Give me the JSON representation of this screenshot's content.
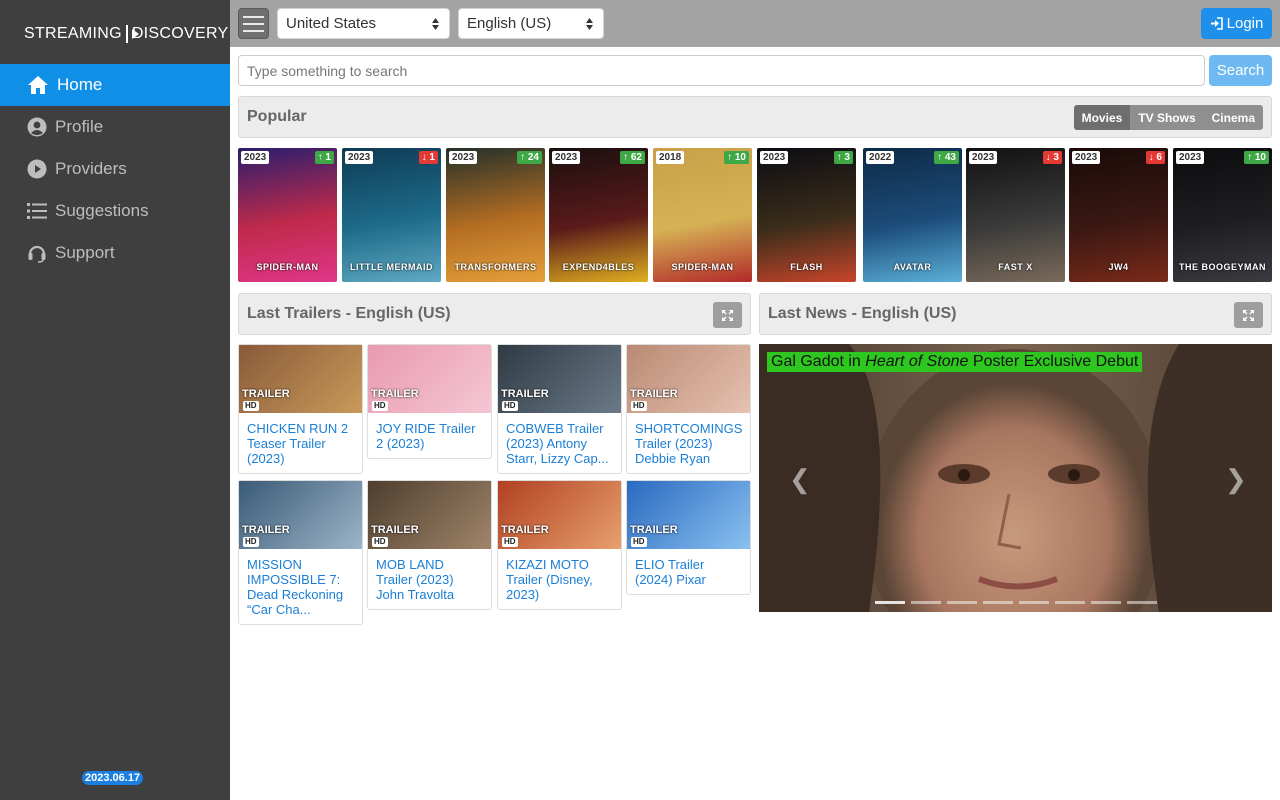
{
  "sidebar": {
    "logo_left": "STREAMING",
    "logo_right": "DISCOVERY",
    "items": [
      {
        "label": "Home",
        "icon": "home-icon"
      },
      {
        "label": "Profile",
        "icon": "user-circle-icon"
      },
      {
        "label": "Providers",
        "icon": "play-circle-icon"
      },
      {
        "label": "Suggestions",
        "icon": "list-icon"
      },
      {
        "label": "Support",
        "icon": "headset-icon"
      }
    ],
    "version": "2023.06.17"
  },
  "topbar": {
    "country": "United States",
    "language": "English (US)",
    "login_label": "Login"
  },
  "search": {
    "placeholder": "Type something to search",
    "button_label": "Search"
  },
  "popular": {
    "title": "Popular",
    "tabs": [
      "Movies",
      "TV Shows",
      "Cinema"
    ],
    "active_tab": "Movies",
    "movies": [
      {
        "year": "2023",
        "rank": "1",
        "trend": "up",
        "poster_text": "SPIDER-MAN"
      },
      {
        "year": "2023",
        "rank": "1",
        "trend": "down",
        "poster_text": "LITTLE MERMAID"
      },
      {
        "year": "2023",
        "rank": "24",
        "trend": "up",
        "poster_text": "TRANSFORMERS"
      },
      {
        "year": "2023",
        "rank": "62",
        "trend": "up",
        "poster_text": "EXPEND4BLES"
      },
      {
        "year": "2018",
        "rank": "10",
        "trend": "up",
        "poster_text": "SPIDER-MAN"
      },
      {
        "year": "2023",
        "rank": "3",
        "trend": "up",
        "poster_text": "FLASH"
      },
      {
        "year": "2022",
        "rank": "43",
        "trend": "up",
        "poster_text": "AVATAR"
      },
      {
        "year": "2023",
        "rank": "3",
        "trend": "down",
        "poster_text": "FAST X"
      },
      {
        "year": "2023",
        "rank": "6",
        "trend": "down",
        "poster_text": "JW4"
      },
      {
        "year": "2023",
        "rank": "10",
        "trend": "up",
        "poster_text": "THE BOOGEYMAN"
      }
    ]
  },
  "trailers": {
    "title": "Last Trailers - English (US)",
    "badge_trailer": "TRAILER",
    "badge_hd": "HD",
    "items": [
      {
        "title": "CHICKEN RUN 2 Teaser Trailer (2023)"
      },
      {
        "title": "JOY RIDE Trailer 2 (2023)"
      },
      {
        "title": "COBWEB Trailer (2023) Antony Starr, Lizzy Cap..."
      },
      {
        "title": "SHORTCOMINGS Trailer (2023) Debbie Ryan"
      },
      {
        "title": "MISSION IMPOSSIBLE 7: Dead Reckoning “Car Cha..."
      },
      {
        "title": "MOB LAND Trailer (2023) John Travolta"
      },
      {
        "title": "KIZAZI MOTO Trailer (Disney, 2023)"
      },
      {
        "title": "ELIO Trailer (2024) Pixar"
      }
    ]
  },
  "news": {
    "title": "Last News - English (US)",
    "headline_pre": "Gal Gadot in ",
    "headline_em": "Heart of Stone",
    "headline_post": " Poster Exclusive Debut",
    "slides": 8
  },
  "colors": {
    "sidebar_bg": "#3f3f3f",
    "accent": "#0f8fe6",
    "trend_up": "#3da845",
    "trend_down": "#e53935",
    "news_title_bg": "#2ec71f"
  }
}
